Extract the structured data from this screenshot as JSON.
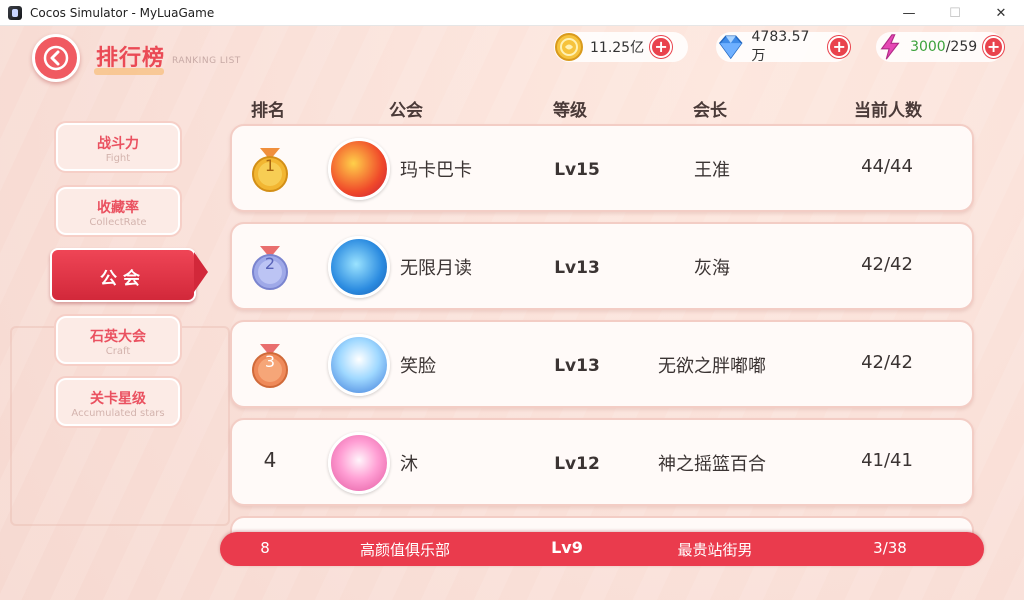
{
  "window": {
    "title": "Cocos Simulator - MyLuaGame",
    "minimize": "—",
    "maximize": "☐",
    "close": "✕"
  },
  "header": {
    "title": "排行榜",
    "subtitle": "RANKING LIST"
  },
  "resources": {
    "gold": "11.25亿",
    "diamond": "4783.57万",
    "energy_current": "3000",
    "energy_max": "/259",
    "plus": "+"
  },
  "sidebar": {
    "tabs": [
      {
        "cn": "战斗力",
        "en": "Fight"
      },
      {
        "cn": "收藏率",
        "en": "CollectRate"
      },
      {
        "cn": "公会",
        "en": ""
      },
      {
        "cn": "石英大会",
        "en": "Craft"
      },
      {
        "cn": "关卡星级",
        "en": "Accumulated stars"
      }
    ],
    "active_index": 2
  },
  "table": {
    "headers": [
      "排名",
      "公会",
      "等级",
      "会长",
      "当前人数"
    ],
    "rows": [
      {
        "rank": "1",
        "guild": "玛卡巴卡",
        "level": "Lv15",
        "leader": "王准",
        "members": "44/44"
      },
      {
        "rank": "2",
        "guild": "无限月读",
        "level": "Lv13",
        "leader": "灰海",
        "members": "42/42"
      },
      {
        "rank": "3",
        "guild": "笑脸",
        "level": "Lv13",
        "leader": "无欲之胖嘟嘟",
        "members": "42/42"
      },
      {
        "rank": "4",
        "guild": "沐",
        "level": "Lv12",
        "leader": "神之摇篮百合",
        "members": "41/41"
      }
    ]
  },
  "my_guild": {
    "rank": "8",
    "guild": "高颜值俱乐部",
    "level": "Lv9",
    "leader": "最贵站街男",
    "members": "3/38"
  },
  "colors": {
    "accent": "#ea3b4d",
    "gold_medal": "#f2b632",
    "silver_medal": "#9fa9e8",
    "bronze_medal": "#ef8a5a"
  }
}
